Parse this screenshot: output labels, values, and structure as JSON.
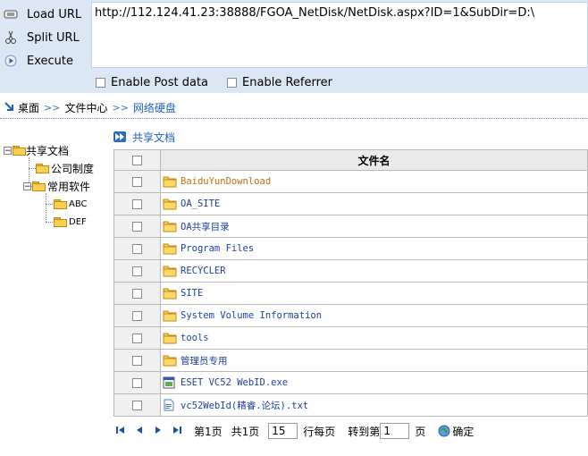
{
  "hackbar": {
    "load_url": "Load URL",
    "split_url": "Split URL",
    "execute": "Execute",
    "url": "http://112.124.41.23:38888/FGOA_NetDisk/NetDisk.aspx?ID=1&SubDir=D:\\",
    "enable_post": "Enable Post data",
    "enable_referrer": "Enable Referrer"
  },
  "breadcrumb": {
    "items": [
      "桌面",
      "文件中心",
      "网络硬盘"
    ],
    "separator": ">>"
  },
  "tree": {
    "root": "共享文档",
    "children": [
      "公司制度",
      "常用软件"
    ],
    "grandchildren": [
      "ABC",
      "DEF"
    ]
  },
  "panel": {
    "title": "共享文档",
    "column_header": "文件名"
  },
  "files": [
    {
      "name": "BaiduYunDownload",
      "icon": "folder-icon"
    },
    {
      "name": "OA_SITE",
      "icon": "folder-icon"
    },
    {
      "name": "OA共享目录",
      "icon": "folder-icon"
    },
    {
      "name": "Program Files",
      "icon": "folder-icon"
    },
    {
      "name": "RECYCLER",
      "icon": "folder-icon"
    },
    {
      "name": "SITE",
      "icon": "folder-icon"
    },
    {
      "name": "System Volume Information",
      "icon": "folder-icon"
    },
    {
      "name": "tools",
      "icon": "folder-icon"
    },
    {
      "name": "管理员专用",
      "icon": "folder-icon"
    },
    {
      "name": "ESET VC52 WebID.exe",
      "icon": "exe-icon"
    },
    {
      "name": "vc52WebId(精睿.论坛).txt",
      "icon": "txt-icon"
    }
  ],
  "pager": {
    "page_info": "第1页",
    "total_info": "共1页",
    "per_page_value": "15",
    "per_page_label": "行每页",
    "goto_label": "转到第",
    "goto_value": "1",
    "page_suffix": "页",
    "confirm": "确定"
  },
  "colors": {
    "link": "#1f5fbf",
    "hackbar_bg": "#dce7f5",
    "first_file": "#c26b12"
  }
}
